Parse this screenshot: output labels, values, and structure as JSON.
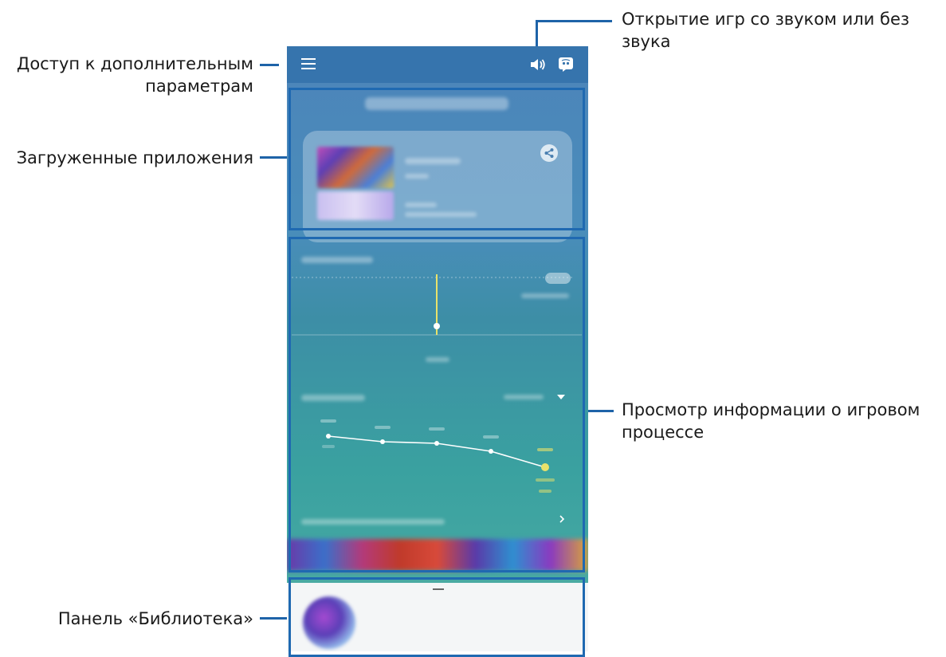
{
  "annotations": {
    "sound_toggle": "Открытие игр со звуком или без звука",
    "more_options": "Доступ к дополнительным параметрам",
    "downloaded_apps": "Загруженные приложения",
    "gameplay_info": "Просмотр информации о игровом процессе",
    "library_panel": "Панель «Библиотека»"
  },
  "colors": {
    "accent_frame": "#1f69b1",
    "top_bar": "#3674ad",
    "highlight_yellow": "#e9e26a"
  },
  "icons": {
    "menu": "menu-icon",
    "sound": "speaker-icon",
    "discord": "discord-icon",
    "share": "share-icon",
    "chevron": "chevron-right-icon",
    "dropdown": "dropdown-arrow-icon"
  }
}
